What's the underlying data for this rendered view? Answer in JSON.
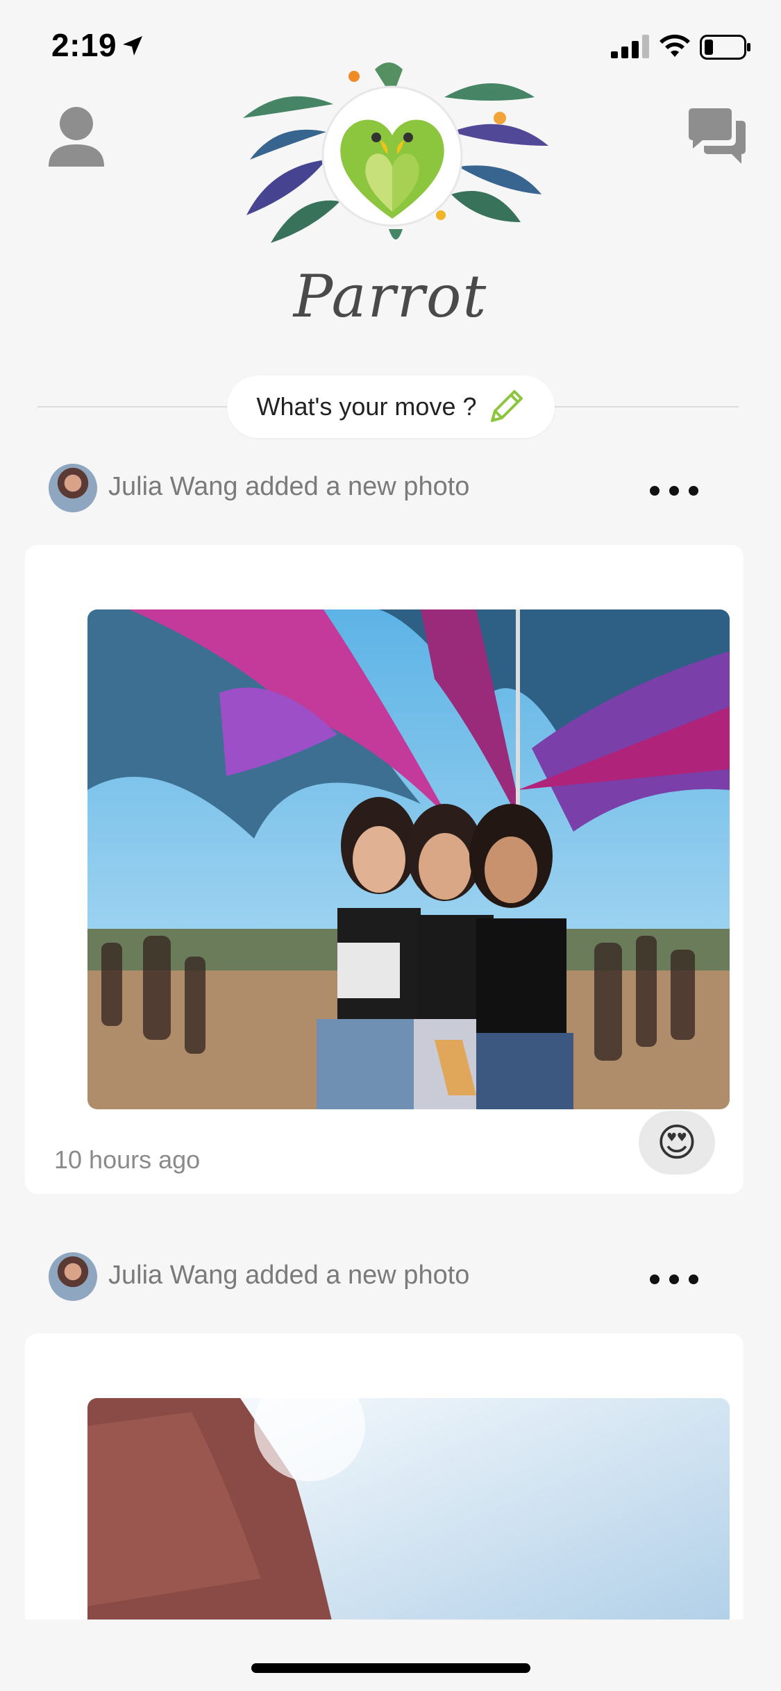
{
  "status_bar": {
    "time": "2:19"
  },
  "header": {
    "brand_name": "Parrot",
    "profile_icon": "person-icon",
    "chat_icon": "chat-bubbles-icon"
  },
  "compose": {
    "prompt": "What's your move ?",
    "icon": "pencil-icon"
  },
  "feed": [
    {
      "author_action": "Julia Wang added a new photo",
      "timestamp": "10 hours ago",
      "reaction": "😍"
    },
    {
      "author_action": "Julia Wang added a new photo"
    }
  ],
  "colors": {
    "background": "#f5f6f5",
    "accent_green": "#8cc63f",
    "icon_gray": "#8e8e8e"
  }
}
